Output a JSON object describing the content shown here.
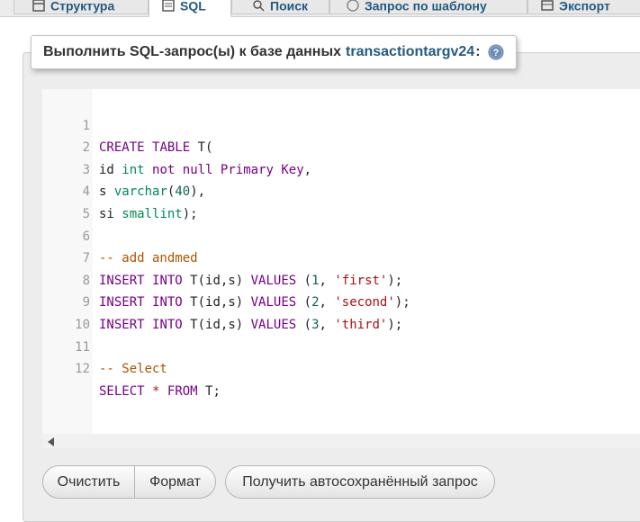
{
  "tabs": [
    {
      "label": "Структура",
      "icon": "structure-icon"
    },
    {
      "label": "SQL",
      "icon": "sql-icon",
      "active": true
    },
    {
      "label": "Поиск",
      "icon": "search-icon"
    },
    {
      "label": "Запрос по шаблону",
      "icon": "query-icon"
    },
    {
      "label": "Экспорт",
      "icon": "export-icon"
    }
  ],
  "legend": {
    "prefix": "Выполнить SQL-запрос(ы) к базе данных",
    "database": "transactiontargv24",
    "colon": ":",
    "help_icon": "help-icon"
  },
  "editor": {
    "lines": [
      {
        "n": "1"
      },
      {
        "n": "2"
      },
      {
        "n": "3"
      },
      {
        "n": "4"
      },
      {
        "n": "5"
      },
      {
        "n": "6"
      },
      {
        "n": "7"
      },
      {
        "n": "8"
      },
      {
        "n": "9"
      },
      {
        "n": "10"
      },
      {
        "n": "11"
      },
      {
        "n": "12"
      }
    ],
    "tokens": {
      "create": "CREATE",
      "table": "TABLE",
      "t": "T",
      "lparen": "(",
      "id": "id",
      "int": "int",
      "not": "not",
      "null": "null",
      "primary_key": "Primary Key",
      "comma": ",",
      "s": "s",
      "varchar": "varchar",
      "n40": "40",
      "rparen_comma": "),",
      "si": "si",
      "smallint": "smallint",
      "semi": ";",
      "comment1": "-- add andmed",
      "insert": "INSERT",
      "into": "INTO",
      "t_cols": "T(id,s)",
      "values": "VALUES",
      "n1": "1",
      "n2": "2",
      "n3": "3",
      "first": "'first'",
      "second": "'second'",
      "third": "'third'",
      "comment2": "-- Select",
      "select": "SELECT",
      "star": "*",
      "from": "FROM",
      "t_semi": "T;"
    }
  },
  "buttons": {
    "clear": "Очистить",
    "format": "Формат",
    "autosave": "Получить автосохранённый запрос"
  }
}
